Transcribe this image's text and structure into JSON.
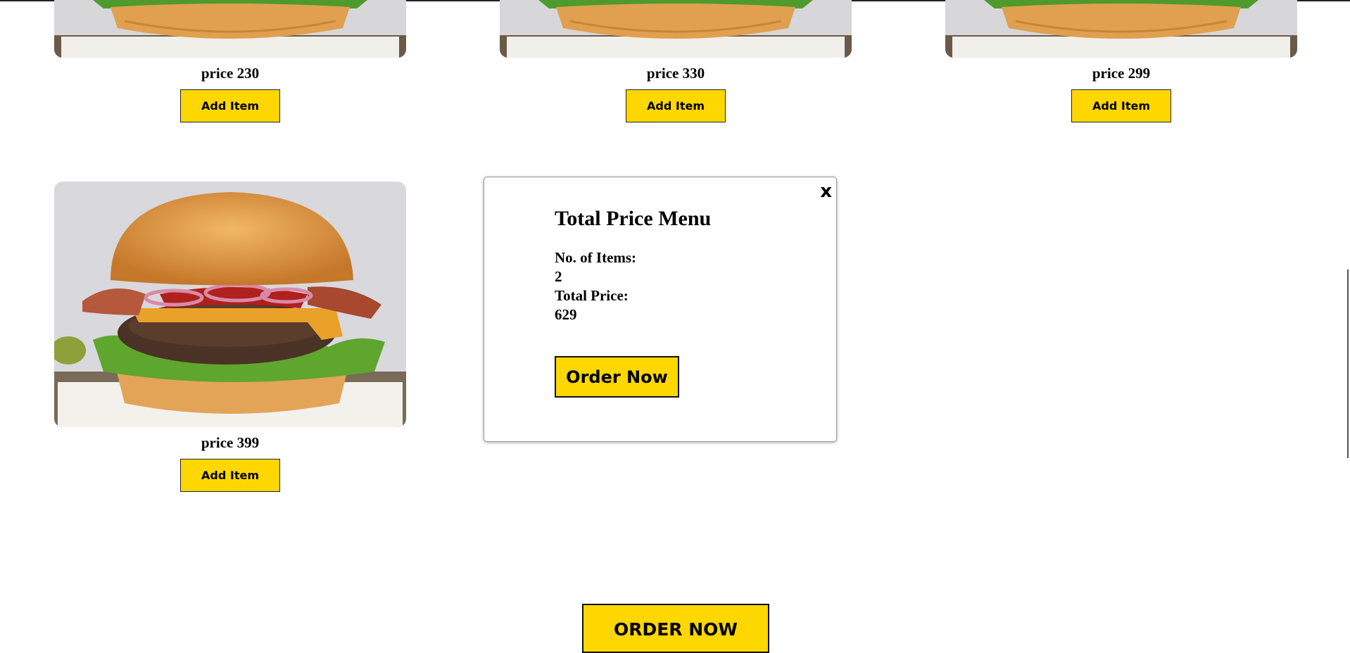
{
  "menu": {
    "items": [
      {
        "price_label": "price 230",
        "add_label": "Add Item"
      },
      {
        "price_label": "price 330",
        "add_label": "Add Item"
      },
      {
        "price_label": "price 299",
        "add_label": "Add Item"
      },
      {
        "price_label": "price 399",
        "add_label": "Add Item"
      }
    ],
    "order_now_label": "ORDER NOW"
  },
  "modal": {
    "close_label": "x",
    "title": "Total Price Menu",
    "items_label": "No. of Items:",
    "items_value": "2",
    "total_label": "Total Price:",
    "total_value": "629",
    "order_button": "Order Now"
  },
  "colors": {
    "accent": "#ffd700",
    "border": "#222222"
  },
  "icons": {
    "close": "close-icon"
  }
}
